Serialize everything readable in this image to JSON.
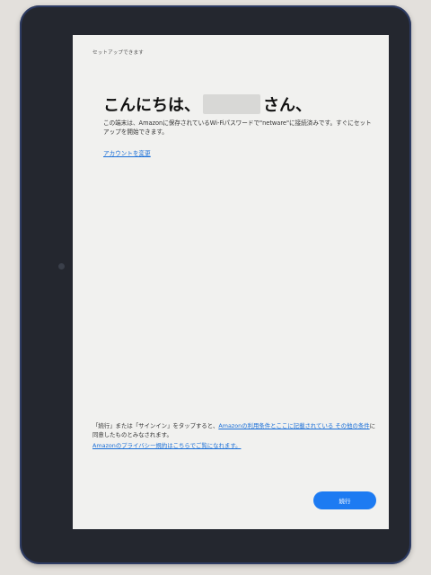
{
  "header": {
    "title": "セットアップできます"
  },
  "greeting": {
    "prefix": "こんにちは、",
    "suffix": "さん、"
  },
  "description": "この端末は、Amazonに保存されているWi-Fiパスワードで\"netware\"に接続済みです。すぐにセットアップを開始できます。",
  "links": {
    "change_account": "アカウントを変更"
  },
  "terms": {
    "prefix": "「続行」または「サインイン」をタップすると、",
    "link": "Amazonの利用条件とここに記載されている その他の条件",
    "suffix": "に同意したものとみなされます。"
  },
  "privacy_link": "Amazonのプライバシー規約はこちらでご覧になれます。",
  "buttons": {
    "continue": "続行"
  },
  "colors": {
    "accent": "#1d7bf2",
    "link": "#1a6fd8",
    "screen": "#f1f1ef",
    "bezel": "#24272f"
  }
}
